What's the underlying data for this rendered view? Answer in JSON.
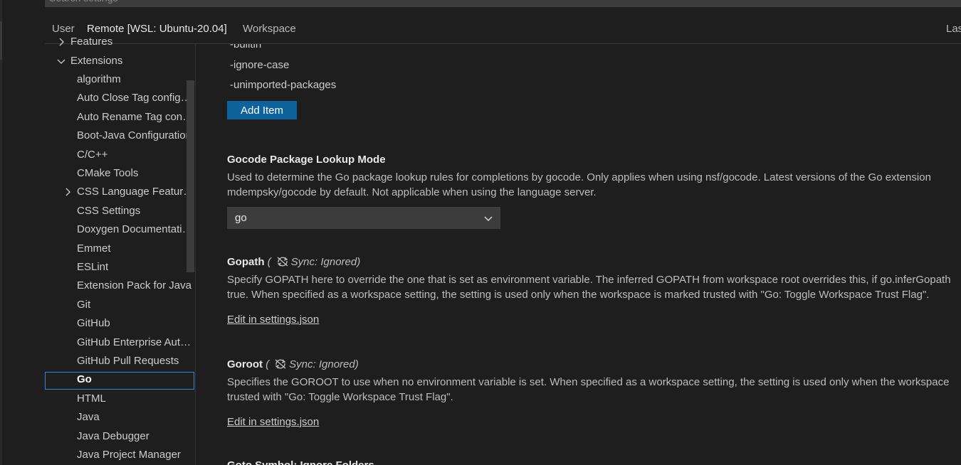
{
  "search": {
    "placeholder": "Search settings"
  },
  "scope_tabs": [
    {
      "label": "User"
    },
    {
      "label": "Remote [WSL: Ubuntu-20.04]"
    },
    {
      "label": "Workspace"
    },
    {
      "label": "Las"
    }
  ],
  "toc": {
    "items": [
      {
        "label": "Features"
      },
      {
        "label": "Extensions"
      },
      {
        "label": "algorithm"
      },
      {
        "label": "Auto Close Tag configuration"
      },
      {
        "label": "Auto Rename Tag configuration"
      },
      {
        "label": "Boot-Java Configuration"
      },
      {
        "label": "C/C++"
      },
      {
        "label": "CMake Tools"
      },
      {
        "label": "CSS Language Features"
      },
      {
        "label": "CSS Settings"
      },
      {
        "label": "Doxygen Documentation Generator"
      },
      {
        "label": "Emmet"
      },
      {
        "label": "ESLint"
      },
      {
        "label": "Extension Pack for Java"
      },
      {
        "label": "Git"
      },
      {
        "label": "GitHub"
      },
      {
        "label": "GitHub Enterprise Authentication"
      },
      {
        "label": "GitHub Pull Requests"
      },
      {
        "label": "Go"
      },
      {
        "label": "HTML"
      },
      {
        "label": "Java"
      },
      {
        "label": "Java Debugger"
      },
      {
        "label": "Java Project Manager"
      }
    ]
  },
  "main": {
    "list_items": [
      "-builtin",
      "-ignore-case",
      "-unimported-packages"
    ],
    "add_item_label": "Add Item",
    "lookup_mode": {
      "title": "Gocode Package Lookup Mode",
      "desc_line1": "Used to determine the Go package lookup rules for completions by gocode. Only applies when using nsf/gocode. Latest versions of the Go extension",
      "desc_line2": "mdempsky/gocode by default. Not applicable when using the language server.",
      "selected": "go"
    },
    "gopath": {
      "title": "Gopath",
      "sync": "Sync: Ignored)",
      "sync_open": "(",
      "desc_line1": "Specify GOPATH here to override the one that is set as environment variable. The inferred GOPATH from workspace root overrides this, if go.inferGopath",
      "desc_line2": "true. When specified as a workspace setting, the setting is used only when the workspace is marked trusted with \"Go: Toggle Workspace Trust Flag\".",
      "edit_link": "Edit in settings.json"
    },
    "goroot": {
      "title": "Goroot",
      "sync": "Sync: Ignored)",
      "sync_open": "(",
      "desc_line1": "Specifies the GOROOT to use when no environment variable is set. When specified as a workspace setting, the setting is used only when the workspace",
      "desc_line2": "trusted with \"Go: Toggle Workspace Trust Flag\".",
      "edit_link": "Edit in settings.json"
    },
    "next_title": "Goto Symbol: Ignore Folders"
  },
  "colors": {
    "accent": "#0e639c",
    "focus_border": "#2d8ad9",
    "background": "#1e1e1e"
  }
}
